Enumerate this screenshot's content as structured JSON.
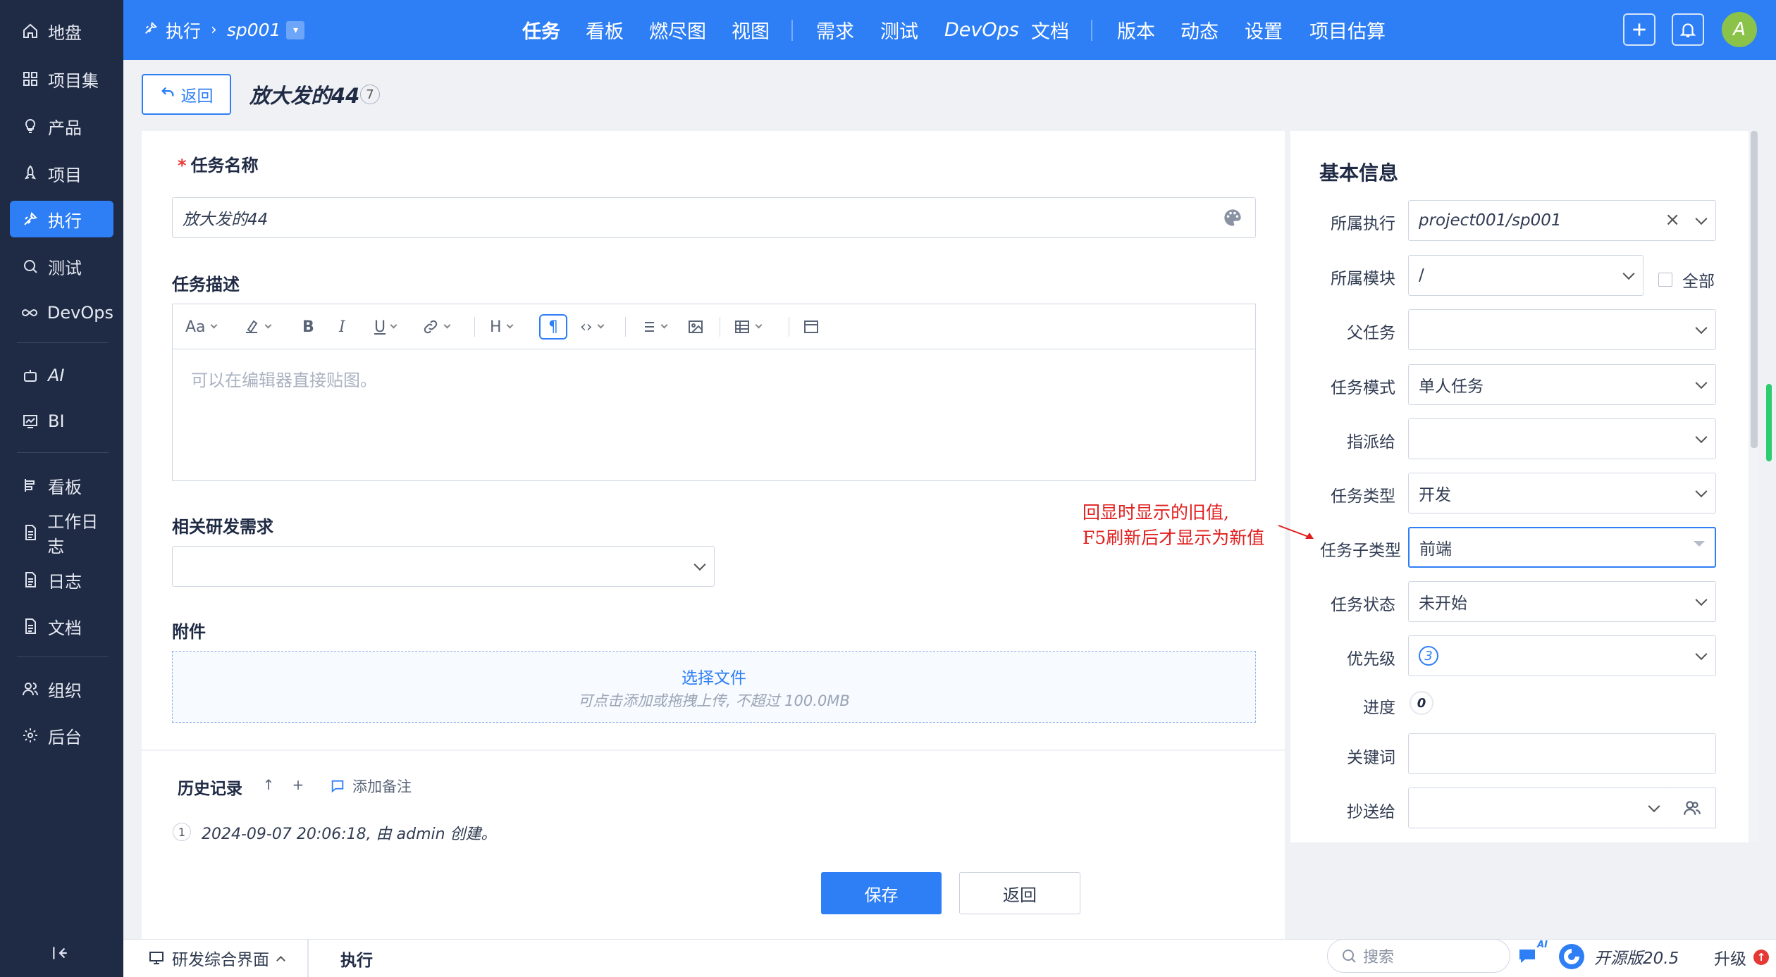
{
  "sidebar": {
    "items": [
      {
        "label": "地盘",
        "icon": "home-icon"
      },
      {
        "label": "项目集",
        "icon": "grid-icon"
      },
      {
        "label": "产品",
        "icon": "bulb-icon"
      },
      {
        "label": "项目",
        "icon": "rocket-icon"
      },
      {
        "label": "执行",
        "icon": "execution-icon"
      },
      {
        "label": "测试",
        "icon": "test-icon"
      },
      {
        "label": "DevOps",
        "icon": "infinity-icon"
      },
      {
        "label": "AI",
        "icon": "robot-icon"
      },
      {
        "label": "BI",
        "icon": "chart-icon"
      },
      {
        "label": "看板",
        "icon": "board-icon"
      },
      {
        "label": "工作日志",
        "icon": "doc-icon"
      },
      {
        "label": "日志",
        "icon": "doc-icon"
      },
      {
        "label": "文档",
        "icon": "doc-icon"
      },
      {
        "label": "组织",
        "icon": "people-icon"
      },
      {
        "label": "后台",
        "icon": "gear-icon"
      }
    ],
    "active": "执行"
  },
  "header": {
    "module": "执行",
    "execution": "sp001",
    "nav": [
      {
        "label": "任务",
        "active": true
      },
      {
        "label": "看板"
      },
      {
        "label": "燃尽图"
      },
      {
        "label": "视图"
      },
      {
        "label": "需求"
      },
      {
        "label": "测试"
      },
      {
        "label": "DevOps"
      },
      {
        "label": "文档"
      },
      {
        "label": "版本"
      },
      {
        "label": "动态"
      },
      {
        "label": "设置"
      },
      {
        "label": "项目估算"
      }
    ],
    "avatar": "A",
    "accent": "#2e7ff5"
  },
  "titlebar": {
    "back_label": "返回",
    "title": "放大发的44",
    "count": "7"
  },
  "form": {
    "name_label": "任务名称",
    "name_value": "放大发的44",
    "desc_label": "任务描述",
    "desc_placeholder": "可以在编辑器直接贴图。",
    "story_label": "相关研发需求",
    "story_value": "",
    "attach_label": "附件",
    "attach_link": "选择文件",
    "attach_hint": "可点击添加或拖拽上传, 不超过 100.0MB"
  },
  "history": {
    "title": "历史记录",
    "add_note": "添加备注",
    "entries": [
      {
        "idx": "1",
        "text": "2024-09-07 20:06:18, 由 admin 创建。"
      }
    ]
  },
  "actions": {
    "save": "保存",
    "back": "返回"
  },
  "info": {
    "title": "基本信息",
    "execution_label": "所属执行",
    "execution_value": "project001/sp001",
    "module_label": "所属模块",
    "module_value": "/",
    "all_label": "全部",
    "parent_label": "父任务",
    "parent_value": "",
    "mode_label": "任务模式",
    "mode_value": "单人任务",
    "assign_label": "指派给",
    "assign_value": "",
    "type_label": "任务类型",
    "type_value": "开发",
    "subtype_label": "任务子类型",
    "subtype_value": "前端",
    "status_label": "任务状态",
    "status_value": "未开始",
    "pri_label": "优先级",
    "pri_value": "3",
    "progress_label": "进度",
    "progress_value": "0",
    "keywords_label": "关键词",
    "keywords_value": "",
    "cc_label": "抄送给",
    "cc_value": ""
  },
  "annotation": {
    "line1": "回显时显示的旧值,",
    "line2": "F5刷新后才显示为新值",
    "color": "#e02020"
  },
  "footer": {
    "workspace": "研发综合界面",
    "current": "执行",
    "search_placeholder": "搜索",
    "ai_badge": "AI",
    "version": "开源版20.5",
    "upgrade": "升级"
  }
}
